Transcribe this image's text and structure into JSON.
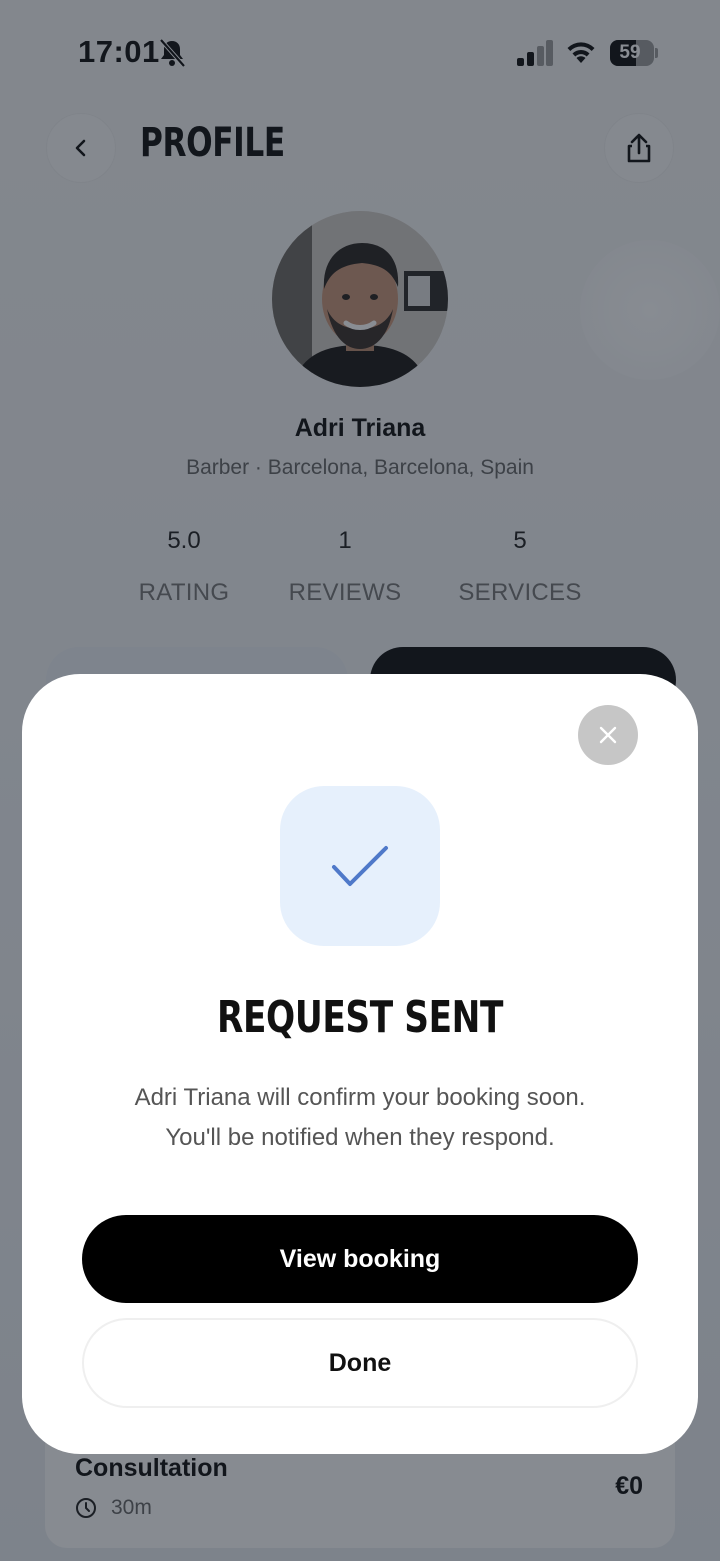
{
  "status_bar": {
    "time": "17:01",
    "battery": "59",
    "battery_level": 0.59,
    "icons": [
      "bell-off-icon",
      "signal-icon",
      "wifi-icon",
      "battery-icon"
    ]
  },
  "header": {
    "title": "PROFILE",
    "back_icon": "chevron-left-icon",
    "share_icon": "share-icon"
  },
  "profile": {
    "name": "Adri Triana",
    "subtitle": "Barber · Barcelona, Barcelona, Spain",
    "stats": [
      {
        "value": "5.0",
        "label": "RATING"
      },
      {
        "value": "1",
        "label": "REVIEWS"
      },
      {
        "value": "5",
        "label": "SERVICES"
      }
    ]
  },
  "service": {
    "name": "Consultation",
    "duration": "30m",
    "price": "€0"
  },
  "modal": {
    "title": "REQUEST SENT",
    "message_line1": "Adri Triana will confirm your booking soon.",
    "message_line2": "You'll be notified when they respond.",
    "primary_label": "View booking",
    "secondary_label": "Done",
    "close_icon": "close-icon",
    "check_icon": "check-icon"
  },
  "colors": {
    "accent": "#4f79c9",
    "check_tile_bg": "#e6f0fc",
    "primary_bg": "#000000"
  }
}
